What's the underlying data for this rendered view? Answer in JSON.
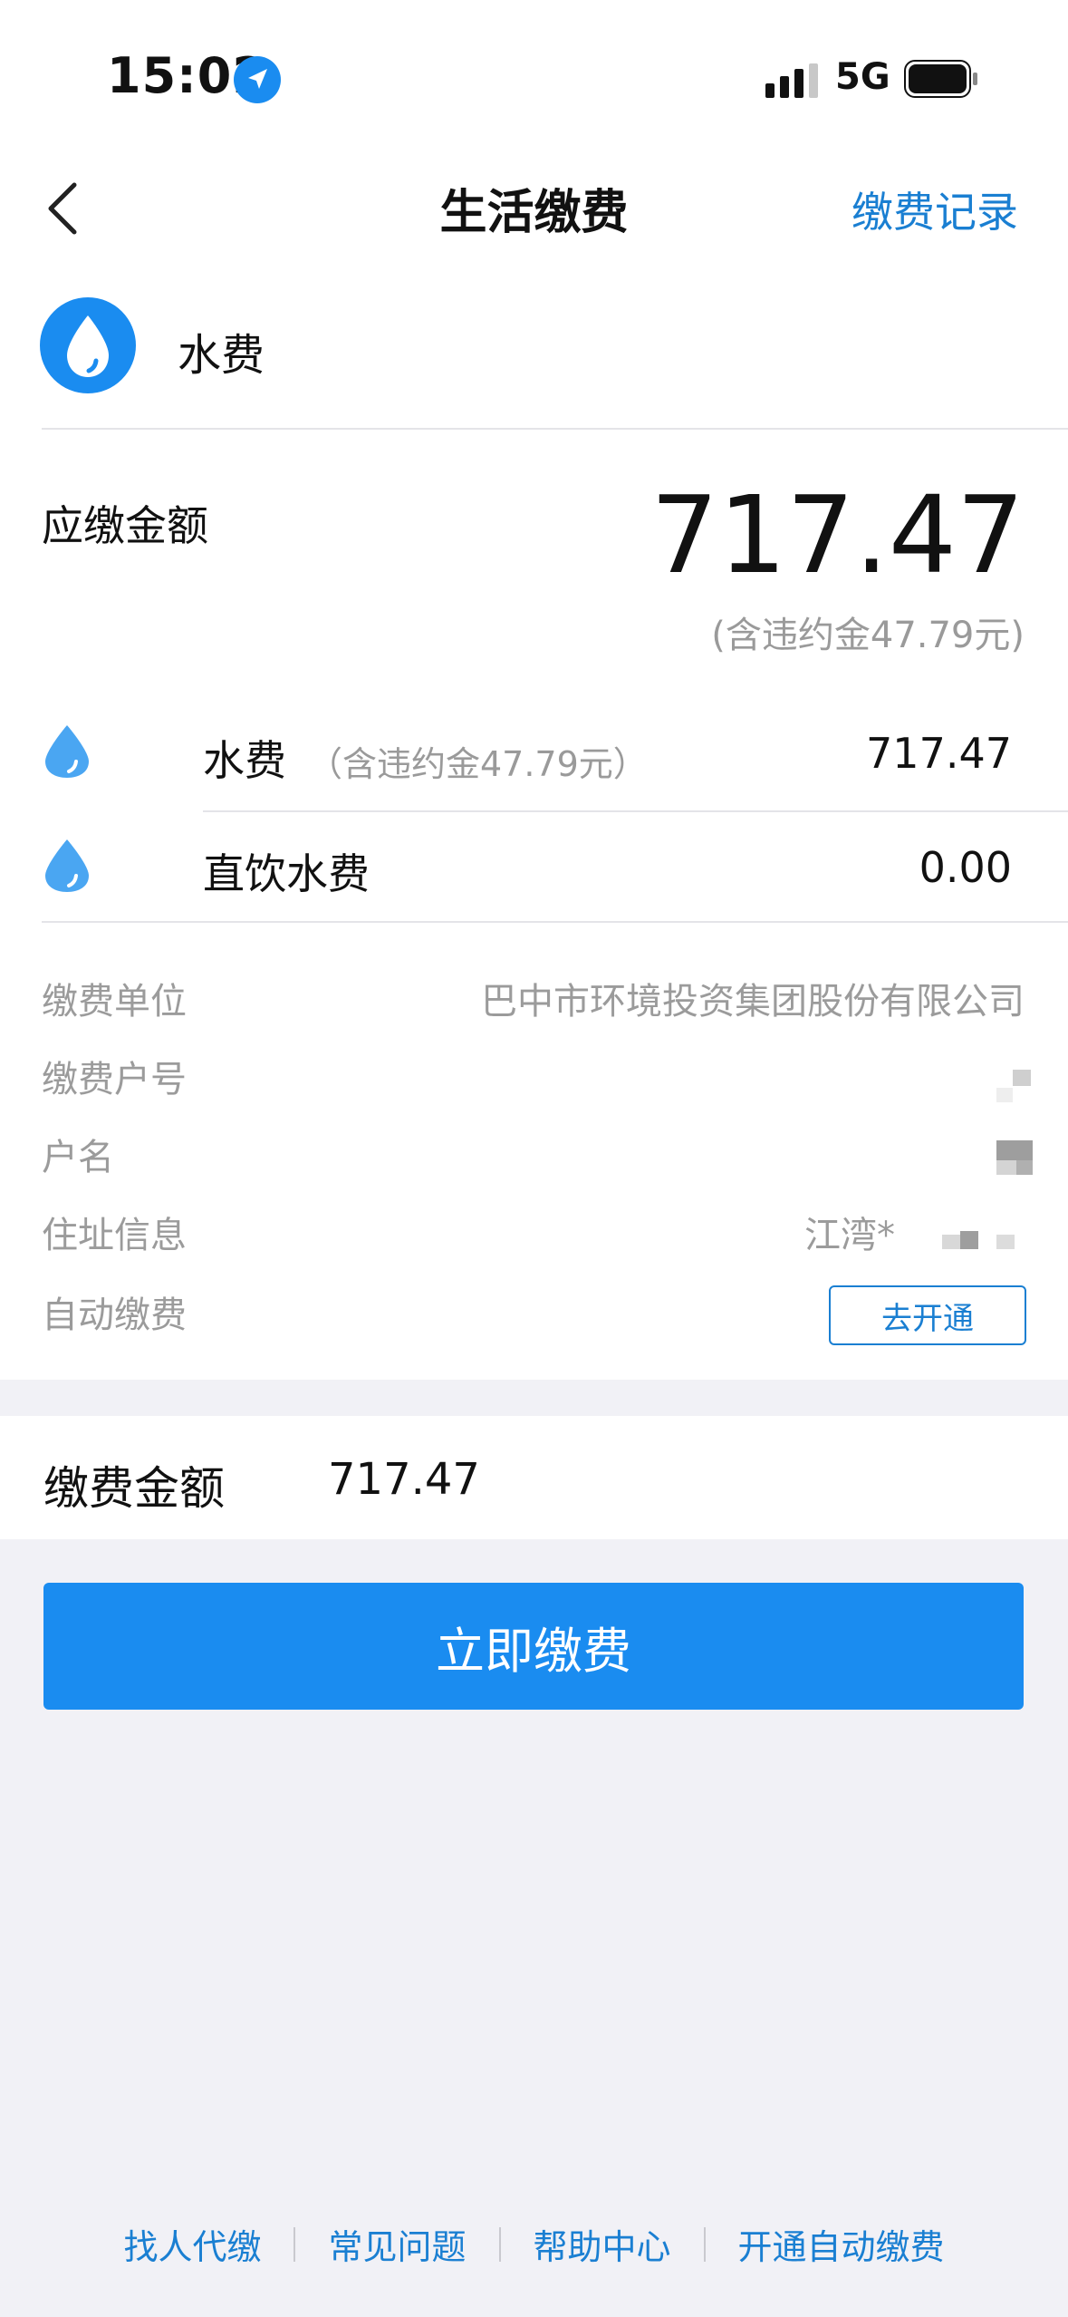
{
  "status_bar": {
    "time": "15:02",
    "network": "5G"
  },
  "nav": {
    "title": "生活缴费",
    "right_link": "缴费记录"
  },
  "bill_type": {
    "label": "水费",
    "icon": "water-drop-icon"
  },
  "amount_due": {
    "label": "应缴金额",
    "value": "717.47",
    "note": "(含违约金47.79元)"
  },
  "items": [
    {
      "label": "水费",
      "note": "（含违约金47.79元）",
      "value": "717.47"
    },
    {
      "label": "直饮水费",
      "note": "",
      "value": "0.00"
    }
  ],
  "info": {
    "company_label": "缴费单位",
    "company_value": "巴中市环境投资集团股份有限公司",
    "account_label": "缴费户号",
    "name_label": "户名",
    "address_label": "住址信息",
    "address_value": "江湾*",
    "auto_label": "自动缴费",
    "auto_button": "去开通"
  },
  "payment": {
    "label": "缴费金额",
    "value": "717.47",
    "button": "立即缴费"
  },
  "footer": {
    "links": [
      "找人代缴",
      "常见问题",
      "帮助中心",
      "开通自动缴费"
    ]
  },
  "colors": {
    "accent": "#1a8cf0",
    "link": "#1a7fd2",
    "muted": "#9b9b9b",
    "background": "#f1f1f6"
  }
}
